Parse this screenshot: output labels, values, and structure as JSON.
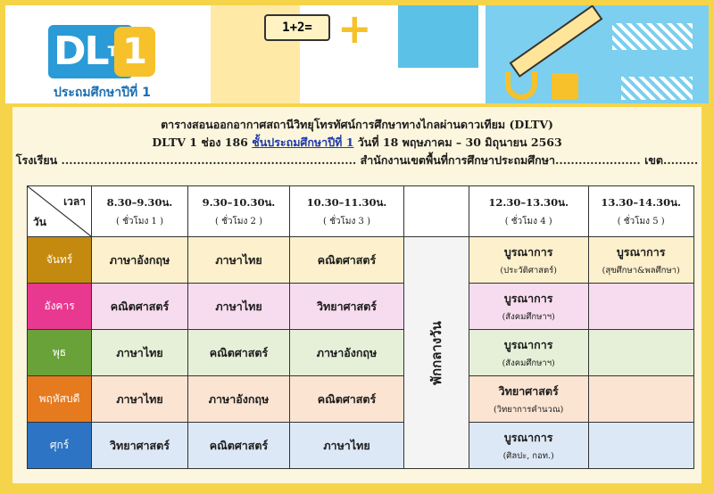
{
  "logo": {
    "main": "DL",
    "small": "TV",
    "num": "1",
    "subtitle": "ประถมศึกษาปีที่ 1"
  },
  "banner": {
    "math_text": "1+2="
  },
  "title": {
    "line1": "ตารางสอนออกอากาศสถานีวิทยุโทรทัศน์การศึกษาทางไกลผ่านดาวเทียม (DLTV)",
    "line2_prefix": "DLTV 1 ช่อง 186 ",
    "line2_highlight": "ชั้นประถมศึกษาปีที่ 1",
    "line2_suffix": " วันที่ 18 พฤษภาคม – 30 มิถุนายน 2563",
    "line3": "โรงเรียน ............................................................................ สำนักงานเขตพื้นที่การศึกษาประถมศึกษา...................... เขต........."
  },
  "header": {
    "corner_time": "เวลา",
    "corner_day": "วัน",
    "periods": [
      {
        "time": "8.30–9.30น.",
        "label": "( ชั่วโมง 1 )"
      },
      {
        "time": "9.30–10.30น.",
        "label": "( ชั่วโมง 2 )"
      },
      {
        "time": "10.30–11.30น.",
        "label": "( ชั่วโมง 3 )"
      },
      {
        "time": "12.30–13.30น.",
        "label": "( ชั่วโมง 4 )"
      },
      {
        "time": "13.30–14.30น.",
        "label": "( ชั่วโมง 5 )"
      }
    ],
    "lunch": "พักกลางวัน"
  },
  "days": [
    {
      "name": "จันทร์",
      "color": "#c48a10",
      "bg": "#fdf0cc",
      "p1": "ภาษาอังกฤษ",
      "p2": "ภาษาไทย",
      "p3": "คณิตศาสตร์",
      "p4": "บูรณาการ",
      "p4_sub": "(ประวัติศาสตร์)",
      "p5": "บูรณาการ",
      "p5_sub": "(สุขศึกษา&พลศึกษา)"
    },
    {
      "name": "อังคาร",
      "color": "#e8388f",
      "bg": "#f7dcef",
      "p1": "คณิตศาสตร์",
      "p2": "ภาษาไทย",
      "p3": "วิทยาศาสตร์",
      "p4": "บูรณาการ",
      "p4_sub": "(สังคมศึกษาฯ)",
      "p5": "",
      "p5_sub": ""
    },
    {
      "name": "พุธ",
      "color": "#6aa23a",
      "bg": "#e6f0d8",
      "p1": "ภาษาไทย",
      "p2": "คณิตศาสตร์",
      "p3": "ภาษาอังกฤษ",
      "p4": "บูรณาการ",
      "p4_sub": "(สังคมศึกษาฯ)",
      "p5": "",
      "p5_sub": ""
    },
    {
      "name": "พฤหัสบดี",
      "color": "#e67a1e",
      "bg": "#fbe4d2",
      "p1": "ภาษาไทย",
      "p2": "ภาษาอังกฤษ",
      "p3": "คณิตศาสตร์",
      "p4": "วิทยาศาสตร์",
      "p4_sub": "(วิทยาการคำนวณ)",
      "p5": "",
      "p5_sub": ""
    },
    {
      "name": "ศุกร์",
      "color": "#2d74c4",
      "bg": "#dde8f6",
      "p1": "วิทยาศาสตร์",
      "p2": "คณิตศาสตร์",
      "p3": "ภาษาไทย",
      "p4": "บูรณาการ",
      "p4_sub": "(ศิลปะ, กอท.)",
      "p5": "",
      "p5_sub": ""
    }
  ]
}
